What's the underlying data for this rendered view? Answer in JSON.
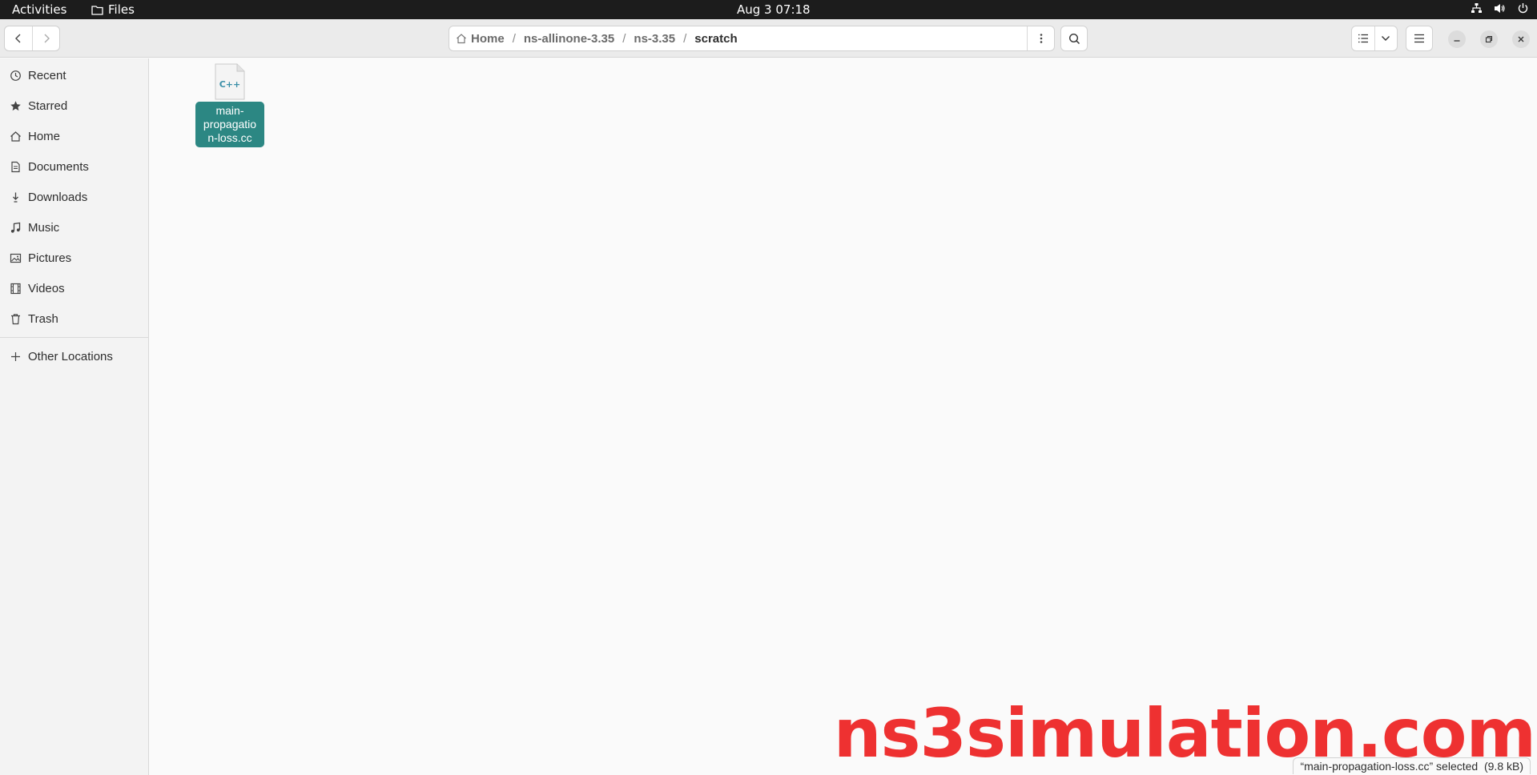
{
  "topbar": {
    "activities": "Activities",
    "app_name": "Files",
    "clock": "Aug 3  07:18"
  },
  "pathbar": {
    "crumbs": [
      "Home",
      "ns-allinone-3.35",
      "ns-3.35",
      "scratch"
    ],
    "separator": "/"
  },
  "sidebar": {
    "items": [
      {
        "label": "Recent",
        "icon": "clock-icon"
      },
      {
        "label": "Starred",
        "icon": "star-icon"
      },
      {
        "label": "Home",
        "icon": "home-icon"
      },
      {
        "label": "Documents",
        "icon": "document-icon"
      },
      {
        "label": "Downloads",
        "icon": "download-icon"
      },
      {
        "label": "Music",
        "icon": "music-icon"
      },
      {
        "label": "Pictures",
        "icon": "picture-icon"
      },
      {
        "label": "Videos",
        "icon": "video-icon"
      },
      {
        "label": "Trash",
        "icon": "trash-icon"
      }
    ],
    "other_locations": "Other Locations"
  },
  "files": [
    {
      "name": "main-propagation-loss.cc",
      "display_lines": [
        "main-",
        "propagatio",
        "n-loss.cc"
      ],
      "icon_text": "C++",
      "selected": true
    }
  ],
  "watermark": "ns3simulation.com",
  "status": "“main-propagation-loss.cc” selected  (9.8 kB)",
  "colors": {
    "selection": "#2c8783",
    "watermark": "#ee3131",
    "topbar": "#1c1c1c"
  }
}
